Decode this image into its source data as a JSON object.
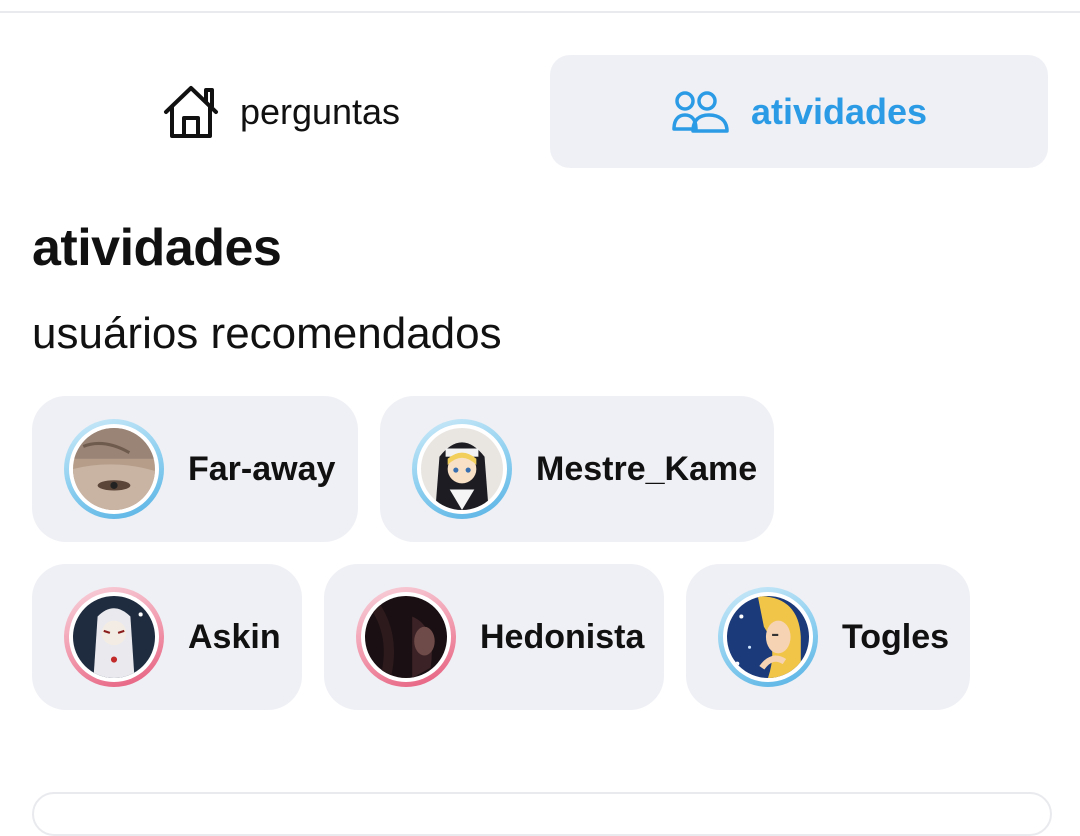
{
  "tabs": [
    {
      "label": "perguntas",
      "icon": "home-icon",
      "active": false
    },
    {
      "label": "atividades",
      "icon": "users-icon",
      "active": true
    }
  ],
  "section": {
    "title": "atividades",
    "subtitle": "usuários recomendados"
  },
  "users": [
    {
      "name": "Far-away",
      "ring": "blue"
    },
    {
      "name": "Mestre_Kame",
      "ring": "blue"
    },
    {
      "name": "Askin",
      "ring": "pink"
    },
    {
      "name": "Hedonista",
      "ring": "pink"
    },
    {
      "name": "Togles",
      "ring": "blue"
    }
  ],
  "colors": {
    "accent": "#2c9be6",
    "chip_bg": "#eff0f5",
    "ring_blue": "#56b2e4",
    "ring_pink": "#e55b7c"
  }
}
